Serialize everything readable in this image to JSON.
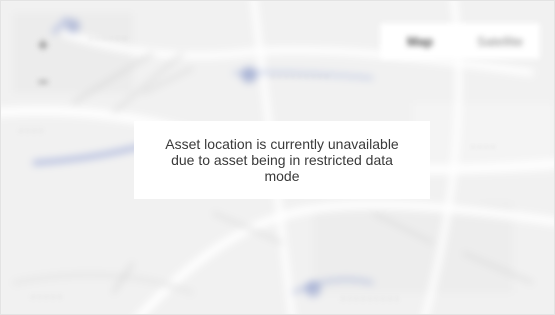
{
  "map": {
    "type_controls": {
      "map_label": "Map",
      "satellite_label": "Satellite"
    },
    "zoom": {
      "in_label": "+",
      "out_label": "−"
    }
  },
  "message": {
    "text": "Asset location is currently unavailable due to asset being in restricted data mode"
  },
  "colors": {
    "map_background": "#f2f2f2",
    "message_background": "#ffffff",
    "message_text": "#3a3a3a",
    "highlight_road": "#7d8fcf"
  }
}
